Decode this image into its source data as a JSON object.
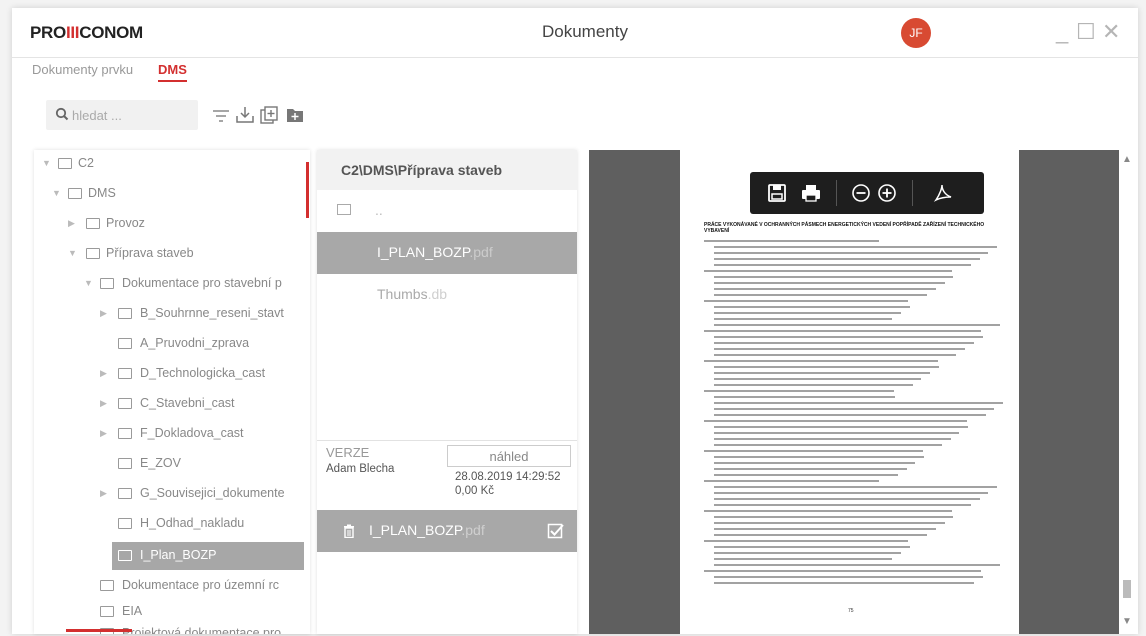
{
  "app": {
    "logo_text": "PROIICONOM",
    "window_title": "Dokumenty",
    "user_initials": "JF",
    "minimize": "_",
    "maximize": "☐",
    "close": "✕"
  },
  "tabs": [
    {
      "label": "Dokumenty prvku",
      "active": false
    },
    {
      "label": "DMS",
      "active": true
    }
  ],
  "search": {
    "placeholder": "hledat ..."
  },
  "toolbar_icons": [
    "filter-icon",
    "download-icon",
    "add-document-icon",
    "add-folder-icon"
  ],
  "tree": [
    {
      "label": "C2",
      "level": 0,
      "expanded": true,
      "has_caret": true
    },
    {
      "label": "DMS",
      "level": 1,
      "expanded": true,
      "has_caret": true
    },
    {
      "label": "Provoz",
      "level": 2,
      "expanded": false,
      "has_caret": true
    },
    {
      "label": "Příprava staveb",
      "level": 2,
      "expanded": true,
      "has_caret": true
    },
    {
      "label": "Dokumentace pro stavební p",
      "level": 3,
      "expanded": true,
      "has_caret": true
    },
    {
      "label": "B_Souhrnne_reseni_stavt",
      "level": 4,
      "expanded": false,
      "has_caret": true
    },
    {
      "label": "A_Pruvodni_zprava",
      "level": 4,
      "expanded": false,
      "has_caret": false
    },
    {
      "label": "D_Technologicka_cast",
      "level": 4,
      "expanded": false,
      "has_caret": true
    },
    {
      "label": "C_Stavebni_cast",
      "level": 4,
      "expanded": false,
      "has_caret": true
    },
    {
      "label": "F_Dokladova_cast",
      "level": 4,
      "expanded": false,
      "has_caret": true
    },
    {
      "label": "E_ZOV",
      "level": 4,
      "expanded": false,
      "has_caret": false
    },
    {
      "label": "G_Souvisejici_dokumente",
      "level": 4,
      "expanded": false,
      "has_caret": true
    },
    {
      "label": "H_Odhad_nakladu",
      "level": 4,
      "expanded": false,
      "has_caret": false
    },
    {
      "label": "I_Plan_BOZP",
      "level": 4,
      "expanded": false,
      "has_caret": false,
      "selected": true
    },
    {
      "label": "Dokumentace pro územní rc",
      "level": 3,
      "expanded": false,
      "has_caret": false
    },
    {
      "label": "EIA",
      "level": 3,
      "expanded": false,
      "has_caret": false
    },
    {
      "label": "Projektová dokumentace pro",
      "level": 3,
      "expanded": false,
      "has_caret": false
    }
  ],
  "files": {
    "path": "C2\\DMS\\Příprava staveb",
    "up_label": "..",
    "items": [
      {
        "name": "I_PLAN_BOZP",
        "ext": ".pdf",
        "selected": true
      },
      {
        "name": "Thumbs",
        "ext": ".db",
        "selected": false
      }
    ]
  },
  "version": {
    "label": "VERZE",
    "preview_button": "náhled",
    "user": "Adam Blecha",
    "date": "28.08.2019 14:29:52",
    "size": "0,00 Kč",
    "file_name": "I_PLAN_BOZP",
    "file_ext": ".pdf"
  },
  "viewer": {
    "toolbar_icons": [
      "save-icon",
      "print-icon",
      "zoom-out-icon",
      "zoom-in-icon",
      "pdf-icon"
    ],
    "page_heading": "PRÁCE VYKONÁVANÉ V OCHRANNÝCH PÁSMECH ENERGETICKÝCH VEDENÍ POPŘÍPADĚ ZAŘÍZENÍ TECHNICKÉHO VYBAVENÍ",
    "page_number": "75"
  },
  "colors": {
    "accent": "#d32f2f",
    "selected": "#a7a7a7",
    "viewer_bg": "#5f5f5f",
    "pdf_toolbar": "#1e1e1e"
  }
}
